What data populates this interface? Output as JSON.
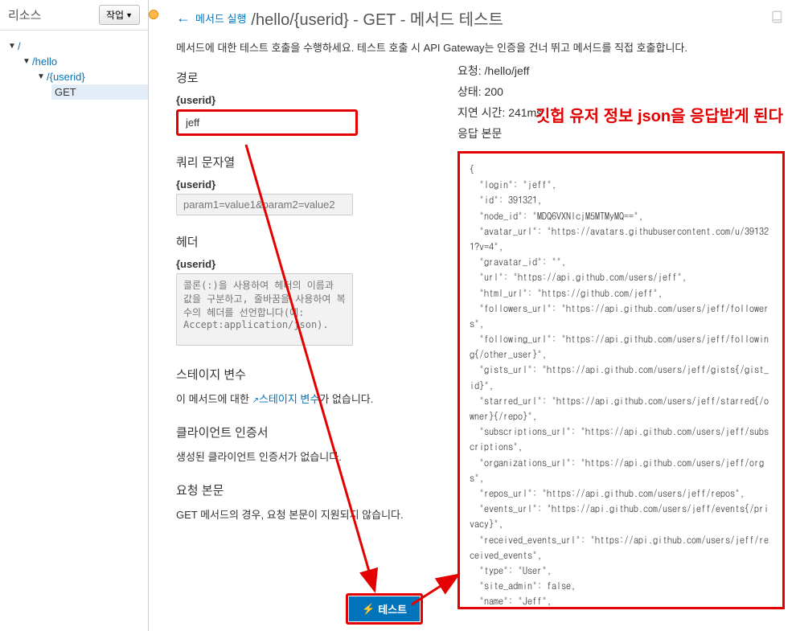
{
  "sidebar": {
    "title": "리소스",
    "actions_label": "작업",
    "tree": {
      "root": "/",
      "hello": "/hello",
      "userid": "/{userid}",
      "get": "GET"
    }
  },
  "breadcrumb": {
    "back_label": "메서드 실행",
    "page_title": "/hello/{userid} - GET - 메서드 테스트"
  },
  "description": "메서드에 대한 테스트 호출을 수행하세요. 테스트 호출 시 API Gateway는 인증을 건너 뛰고 메서드를 직접 호출합니다.",
  "left": {
    "path_heading": "경로",
    "path_param_label": "{userid}",
    "path_param_value": "jeff",
    "query_heading": "쿼리 문자열",
    "query_label": "{userid}",
    "query_placeholder": "param1=value1&param2=value2",
    "headers_heading": "헤더",
    "headers_label": "{userid}",
    "headers_placeholder": "콜론(:)을 사용하여 헤더의 이름과 값을 구분하고, 줄바꿈을 사용하여 복수의 헤더를 선언합니다(예: Accept:application/json).",
    "stage_heading": "스테이지 변수",
    "stage_text_pre": "이 메서드에 대한 ",
    "stage_link": "스테이지 변수",
    "stage_text_post": "가 없습니다.",
    "cert_heading": "클라이언트 인증서",
    "cert_text": "생성된 클라이언트 인증서가 없습니다.",
    "body_heading": "요청 본문",
    "body_text": "GET 메서드의 경우, 요청 본문이 지원되지 않습니다."
  },
  "right": {
    "request_label": "요청: ",
    "request_value": "/hello/jeff",
    "status_label": "상태: ",
    "status_value": "200",
    "latency_label": "지연 시간: ",
    "latency_value": "241ms",
    "body_label": "응답 본문"
  },
  "annotation": "깃헙 유저 정보 json을 응답받게 된다",
  "response_json": {
    "login": "jeff",
    "id": 391321,
    "node_id": "MDQ6VXNlcjM5MTMyMQ==",
    "avatar_url": "https://avatars.githubusercontent.com/u/391321?v=4",
    "gravatar_id": "",
    "url": "https://api.github.com/users/jeff",
    "html_url": "https://github.com/jeff",
    "followers_url": "https://api.github.com/users/jeff/followers",
    "following_url": "https://api.github.com/users/jeff/following{/other_user}",
    "gists_url": "https://api.github.com/users/jeff/gists{/gist_id}",
    "starred_url": "https://api.github.com/users/jeff/starred{/owner}{/repo}",
    "subscriptions_url": "https://api.github.com/users/jeff/subscriptions",
    "organizations_url": "https://api.github.com/users/jeff/orgs",
    "repos_url": "https://api.github.com/users/jeff/repos",
    "events_url": "https://api.github.com/users/jeff/events{/privacy}",
    "received_events_url": "https://api.github.com/users/jeff/received_events",
    "type": "User",
    "site_admin": false,
    "name": "Jeff",
    "company": null,
    "blog": "",
    "location": null
  },
  "test_button": "테스트"
}
